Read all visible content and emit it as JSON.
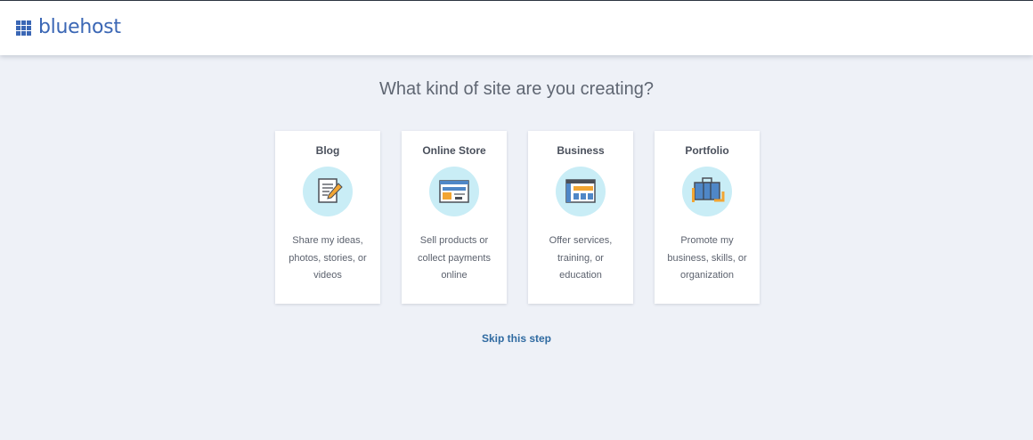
{
  "brand": {
    "name": "bluehost",
    "color": "#3b67b5"
  },
  "page": {
    "title": "What kind of site are you creating?"
  },
  "cards": [
    {
      "title": "Blog",
      "description": "Share my ideas, photos, stories, or videos",
      "icon": "blog-notepad-pencil-icon"
    },
    {
      "title": "Online Store",
      "description": "Sell products or collect payments online",
      "icon": "online-store-browser-icon"
    },
    {
      "title": "Business",
      "description": "Offer services, training, or education",
      "icon": "business-dashboard-icon"
    },
    {
      "title": "Portfolio",
      "description": "Promote my business, skills, or organization",
      "icon": "portfolio-briefcase-icon"
    }
  ],
  "skip": {
    "label": "Skip this step"
  },
  "colors": {
    "background": "#eef1f7",
    "card": "#ffffff",
    "icon_circle": "#c9edf6",
    "link": "#2f6aa1"
  }
}
